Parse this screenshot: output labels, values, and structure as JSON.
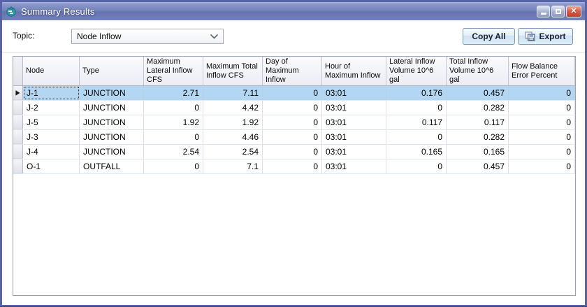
{
  "colors": {
    "window_border": "#5765a8",
    "titlebar_top": "#aab4da",
    "titlebar_bottom": "#6673b1",
    "selection": "#b3d7f2",
    "close_button": "#c53f2c",
    "button_border": "#7898c4"
  },
  "window": {
    "title": "Summary Results"
  },
  "toolbar": {
    "topic_label": "Topic:",
    "topic_value": "Node Inflow",
    "copy_all_label": "Copy All",
    "export_label": "Export"
  },
  "table": {
    "columns": [
      {
        "label": "Node",
        "align": "left"
      },
      {
        "label": "Type",
        "align": "left"
      },
      {
        "label": "Maximum Lateral Inflow CFS",
        "align": "right"
      },
      {
        "label": "Maximum Total Inflow CFS",
        "align": "right"
      },
      {
        "label": "Day of Maximum Inflow",
        "align": "right"
      },
      {
        "label": "Hour of Maximum Inflow",
        "align": "left"
      },
      {
        "label": "Lateral Inflow Volume 10^6 gal",
        "align": "right"
      },
      {
        "label": "Total Inflow Volume 10^6 gal",
        "align": "right"
      },
      {
        "label": "Flow Balance Error Percent",
        "align": "right"
      }
    ],
    "rows": [
      {
        "selected": true,
        "cells": [
          "J-1",
          "JUNCTION",
          "2.71",
          "7.11",
          "0",
          "03:01",
          "0.176",
          "0.457",
          "0"
        ]
      },
      {
        "selected": false,
        "cells": [
          "J-2",
          "JUNCTION",
          "0",
          "4.42",
          "0",
          "03:01",
          "0",
          "0.282",
          "0"
        ]
      },
      {
        "selected": false,
        "cells": [
          "J-5",
          "JUNCTION",
          "1.92",
          "1.92",
          "0",
          "03:01",
          "0.117",
          "0.117",
          "0"
        ]
      },
      {
        "selected": false,
        "cells": [
          "J-3",
          "JUNCTION",
          "0",
          "4.46",
          "0",
          "03:01",
          "0",
          "0.282",
          "0"
        ]
      },
      {
        "selected": false,
        "cells": [
          "J-4",
          "JUNCTION",
          "2.54",
          "2.54",
          "0",
          "03:01",
          "0.165",
          "0.165",
          "0"
        ]
      },
      {
        "selected": false,
        "cells": [
          "O-1",
          "OUTFALL",
          "0",
          "7.1",
          "0",
          "03:01",
          "0",
          "0.457",
          "0"
        ]
      }
    ]
  }
}
